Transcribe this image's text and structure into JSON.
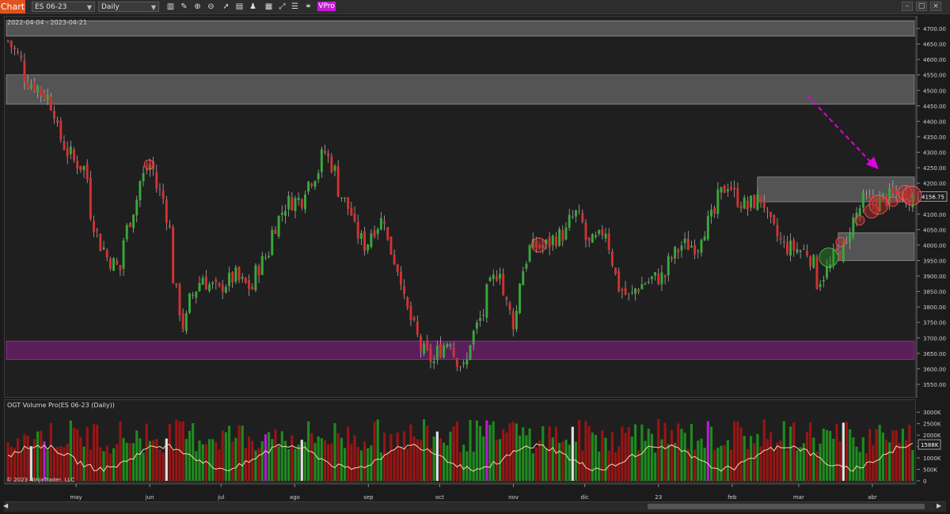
{
  "toolbar": {
    "chart_tab": "Chart",
    "instrument": "ES 06-23",
    "interval": "Daily",
    "vpro_label": "VPro",
    "icons": [
      "bars-icon",
      "pencil-icon",
      "zoom-in-icon",
      "zoom-out-icon",
      "cursor-icon",
      "properties-icon",
      "strategy-icon",
      "data-box-icon",
      "attach-icon",
      "link-icon"
    ]
  },
  "chart": {
    "date_range": "2022-04-04 - 2023-04-21",
    "price_ticks": [
      "4700.00",
      "4650.00",
      "4600.00",
      "4550.00",
      "4500.00",
      "4450.00",
      "4400.00",
      "4350.00",
      "4300.00",
      "4250.00",
      "4200.00",
      "4150.00",
      "4100.00",
      "4050.00",
      "4000.00",
      "3950.00",
      "3900.00",
      "3850.00",
      "3800.00",
      "3750.00",
      "3700.00",
      "3650.00",
      "3600.00",
      "3550.00"
    ],
    "last_price": "4156.75",
    "month_labels": [
      "may",
      "jun",
      "jul",
      "ago",
      "sep",
      "oct",
      "nov",
      "dic",
      "23",
      "feb",
      "mar",
      "abr"
    ],
    "colors": {
      "up": "#3aa83a",
      "down": "#d23232",
      "zone_gray": "#8a8a8a",
      "zone_purple": "#8a1f8a",
      "arrow": "#e000e0",
      "volume_line": "#f0d9a8"
    }
  },
  "volume": {
    "title": "OGT Volume Pro(ES 06-23 (Daily))",
    "ticks": [
      "3000K",
      "2500K",
      "2000K",
      "1500K",
      "1000K",
      "500K",
      "0"
    ],
    "last_value": "1588K",
    "copyright": "© 2023 NinjaTrader, LLC"
  },
  "chart_data": {
    "type": "candlestick",
    "symbol": "ES 06-23",
    "interval": "Daily",
    "range": [
      "2022-04-04",
      "2023-04-21"
    ],
    "ylim": [
      3525,
      4725
    ],
    "last_price": 4156.75,
    "close_path": [
      [
        "2022-04-04",
        4660
      ],
      [
        "2022-04-12",
        4530
      ],
      [
        "2022-04-20",
        4480
      ],
      [
        "2022-04-28",
        4300
      ],
      [
        "2022-05-05",
        4250
      ],
      [
        "2022-05-12",
        4000
      ],
      [
        "2022-05-20",
        3920
      ],
      [
        "2022-05-27",
        4150
      ],
      [
        "2022-06-02",
        4260
      ],
      [
        "2022-06-08",
        4150
      ],
      [
        "2022-06-16",
        3740
      ],
      [
        "2022-06-24",
        3900
      ],
      [
        "2022-07-01",
        3850
      ],
      [
        "2022-07-08",
        3900
      ],
      [
        "2022-07-15",
        3860
      ],
      [
        "2022-07-22",
        3980
      ],
      [
        "2022-07-29",
        4130
      ],
      [
        "2022-08-05",
        4150
      ],
      [
        "2022-08-11",
        4230
      ],
      [
        "2022-08-16",
        4300
      ],
      [
        "2022-08-19",
        4240
      ],
      [
        "2022-08-26",
        4100
      ],
      [
        "2022-09-01",
        4000
      ],
      [
        "2022-09-09",
        4090
      ],
      [
        "2022-09-16",
        3900
      ],
      [
        "2022-09-23",
        3700
      ],
      [
        "2022-09-30",
        3620
      ],
      [
        "2022-10-07",
        3700
      ],
      [
        "2022-10-13",
        3600
      ],
      [
        "2022-10-20",
        3760
      ],
      [
        "2022-10-28",
        3930
      ],
      [
        "2022-11-03",
        3750
      ],
      [
        "2022-11-10",
        3990
      ],
      [
        "2022-11-17",
        4000
      ],
      [
        "2022-11-25",
        4040
      ],
      [
        "2022-11-30",
        4100
      ],
      [
        "2022-12-06",
        4000
      ],
      [
        "2022-12-13",
        4050
      ],
      [
        "2022-12-16",
        3900
      ],
      [
        "2022-12-22",
        3830
      ],
      [
        "2022-12-29",
        3880
      ],
      [
        "2023-01-06",
        3900
      ],
      [
        "2023-01-13",
        4000
      ],
      [
        "2023-01-20",
        4000
      ],
      [
        "2023-01-27",
        4100
      ],
      [
        "2023-02-02",
        4200
      ],
      [
        "2023-02-10",
        4120
      ],
      [
        "2023-02-16",
        4150
      ],
      [
        "2023-02-24",
        4010
      ],
      [
        "2023-03-01",
        3990
      ],
      [
        "2023-03-08",
        3980
      ],
      [
        "2023-03-13",
        3880
      ],
      [
        "2023-03-17",
        3930
      ],
      [
        "2023-03-24",
        4000
      ],
      [
        "2023-03-31",
        4140
      ],
      [
        "2023-04-06",
        4140
      ],
      [
        "2023-04-14",
        4160
      ],
      [
        "2023-04-21",
        4157
      ]
    ],
    "zones": [
      {
        "color": "gray",
        "low": 4455,
        "high": 4550,
        "from": "2022-04-04",
        "to": "2023-04-21"
      },
      {
        "color": "gray",
        "low": 4675,
        "high": 4725,
        "from": "2022-04-04",
        "to": "2023-04-21"
      },
      {
        "color": "gray",
        "low": 4140,
        "high": 4220,
        "from": "2023-02-14",
        "to": "2023-04-21"
      },
      {
        "color": "gray",
        "low": 3950,
        "high": 4040,
        "from": "2023-03-20",
        "to": "2023-04-21"
      },
      {
        "color": "purple",
        "low": 3630,
        "high": 3690,
        "from": "2022-04-04",
        "to": "2023-04-21"
      }
    ],
    "volume_ylim": [
      0,
      3250
    ]
  }
}
